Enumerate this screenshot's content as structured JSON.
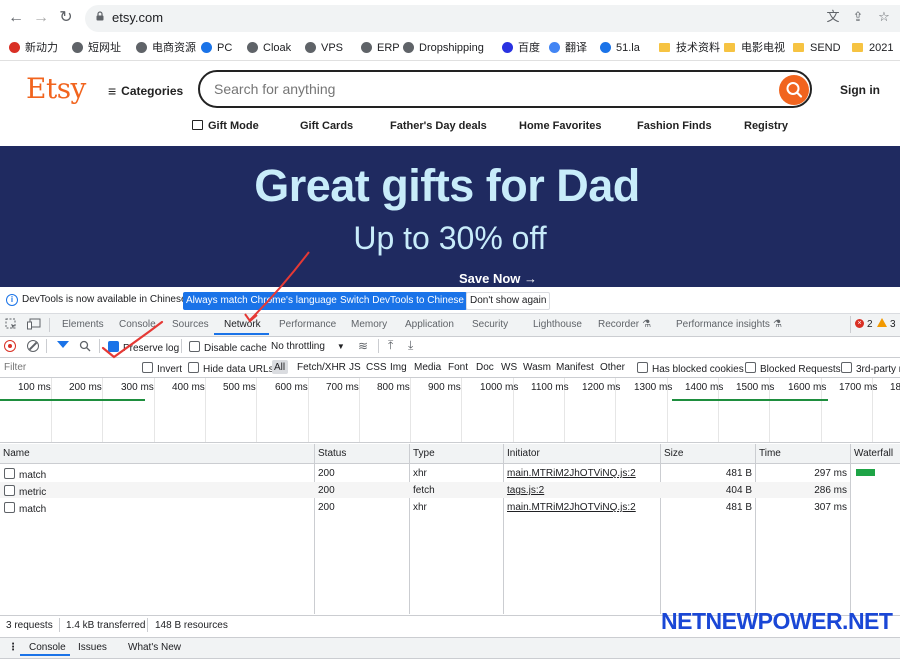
{
  "browser": {
    "url": "etsy.com",
    "bookmarks": [
      {
        "label": "新动力",
        "color": "#d93025"
      },
      {
        "label": "短网址",
        "color": "#5f6368"
      },
      {
        "label": "电商资源",
        "color": "#5f6368"
      },
      {
        "label": "PC",
        "color": "#1a73e8"
      },
      {
        "label": "Cloak",
        "color": "#5f6368"
      },
      {
        "label": "VPS",
        "color": "#5f6368"
      },
      {
        "label": "ERP",
        "color": "#5f6368"
      },
      {
        "label": "Dropshipping",
        "color": "#5f6368"
      },
      {
        "label": "百度",
        "color": "#2932e1"
      },
      {
        "label": "翻译",
        "color": "#4285f4"
      },
      {
        "label": "51.la",
        "color": "#1a73e8"
      },
      {
        "label": "技术资料",
        "color": "#f6c342"
      },
      {
        "label": "电影电视",
        "color": "#f6c342"
      },
      {
        "label": "SEND",
        "color": "#f6c342"
      },
      {
        "label": "2021",
        "color": "#f6c342"
      }
    ]
  },
  "etsy": {
    "logo": "Etsy",
    "categories_label": "Categories",
    "search_placeholder": "Search for anything",
    "signin_label": "Sign in",
    "nav": [
      "Gift Mode",
      "Gift Cards",
      "Father's Day deals",
      "Home Favorites",
      "Fashion Finds",
      "Registry"
    ],
    "banner": {
      "title": "Great gifts for Dad",
      "subtitle": "Up to 30% off",
      "cta": "Save Now →"
    }
  },
  "devtools": {
    "infobar": {
      "text": "DevTools is now available in Chinese!",
      "btn_match": "Always match Chrome's language",
      "btn_switch": "Switch DevTools to Chinese",
      "btn_dismiss": "Don't show again"
    },
    "tabs": [
      "Elements",
      "Console",
      "Sources",
      "Network",
      "Performance",
      "Memory",
      "Application",
      "Security",
      "Lighthouse",
      "Recorder",
      "Performance insights"
    ],
    "active_tab": "Network",
    "errors": "2",
    "warnings": "3",
    "toolbar": {
      "preserve_log": "Preserve log",
      "disable_cache": "Disable cache",
      "throttling": "No throttling"
    },
    "filter": {
      "placeholder": "Filter",
      "invert": "Invert",
      "hide_data_urls": "Hide data URLs",
      "types": [
        "All",
        "Fetch/XHR",
        "JS",
        "CSS",
        "Img",
        "Media",
        "Font",
        "Doc",
        "WS",
        "Wasm",
        "Manifest",
        "Other"
      ],
      "blocked_cookies": "Has blocked cookies",
      "blocked_requests": "Blocked Requests",
      "third_party": "3rd-party r"
    },
    "timeline_ticks": [
      "100 ms",
      "200 ms",
      "300 ms",
      "400 ms",
      "500 ms",
      "600 ms",
      "700 ms",
      "800 ms",
      "900 ms",
      "1000 ms",
      "1100 ms",
      "1200 ms",
      "1300 ms",
      "1400 ms",
      "1500 ms",
      "1600 ms",
      "1700 ms",
      "180"
    ],
    "columns": [
      "Name",
      "Status",
      "Type",
      "Initiator",
      "Size",
      "Time",
      "Waterfall"
    ],
    "rows": [
      {
        "name": "match",
        "status": "200",
        "type": "xhr",
        "initiator": "main.MTRiM2JhOTViNQ.js:2",
        "size": "481 B",
        "time": "297 ms"
      },
      {
        "name": "metric",
        "status": "200",
        "type": "fetch",
        "initiator": "tags.js:2",
        "size": "404 B",
        "time": "286 ms"
      },
      {
        "name": "match",
        "status": "200",
        "type": "xhr",
        "initiator": "main.MTRiM2JhOTViNQ.js:2",
        "size": "481 B",
        "time": "307 ms"
      }
    ],
    "status": {
      "requests": "3 requests",
      "transferred": "1.4 kB transferred",
      "resources": "148 B resources"
    },
    "drawer_tabs": [
      "Console",
      "Issues",
      "What's New"
    ]
  },
  "watermark": "NETNEWPOWER.NET"
}
